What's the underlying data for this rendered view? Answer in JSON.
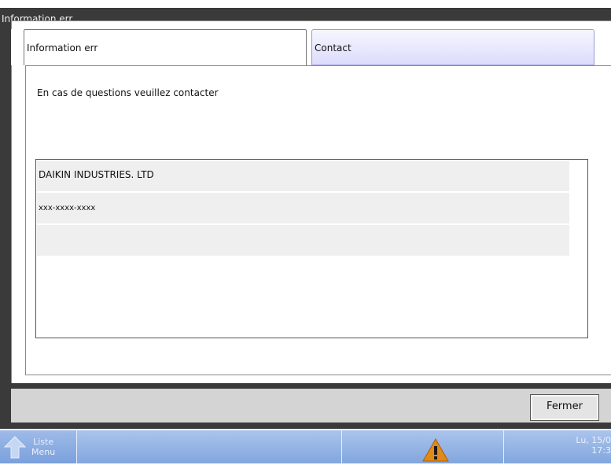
{
  "dialog": {
    "title": "Information err",
    "tabs": [
      {
        "label": "Information err"
      },
      {
        "label": "Contact"
      }
    ],
    "active_tab": "Contact",
    "intro_text": "En cas de questions veuillez contacter",
    "contact_rows": [
      "DAIKIN INDUSTRIES. LTD",
      "xxx-xxxx-xxxx",
      ""
    ],
    "close_label": "Fermer"
  },
  "taskbar": {
    "menu_label_line1": "Liste",
    "menu_label_line2": "Menu",
    "date": "Lu, 15/0",
    "time": "17:3"
  },
  "icons": {
    "menu_arrow": "up-arrow-icon",
    "alert": "warning-icon"
  },
  "colors": {
    "dialog_frame": "#3a3a3a",
    "active_tab": "#dcdcfc",
    "taskbar": "#82a6de",
    "warning": "#e08a1a"
  }
}
